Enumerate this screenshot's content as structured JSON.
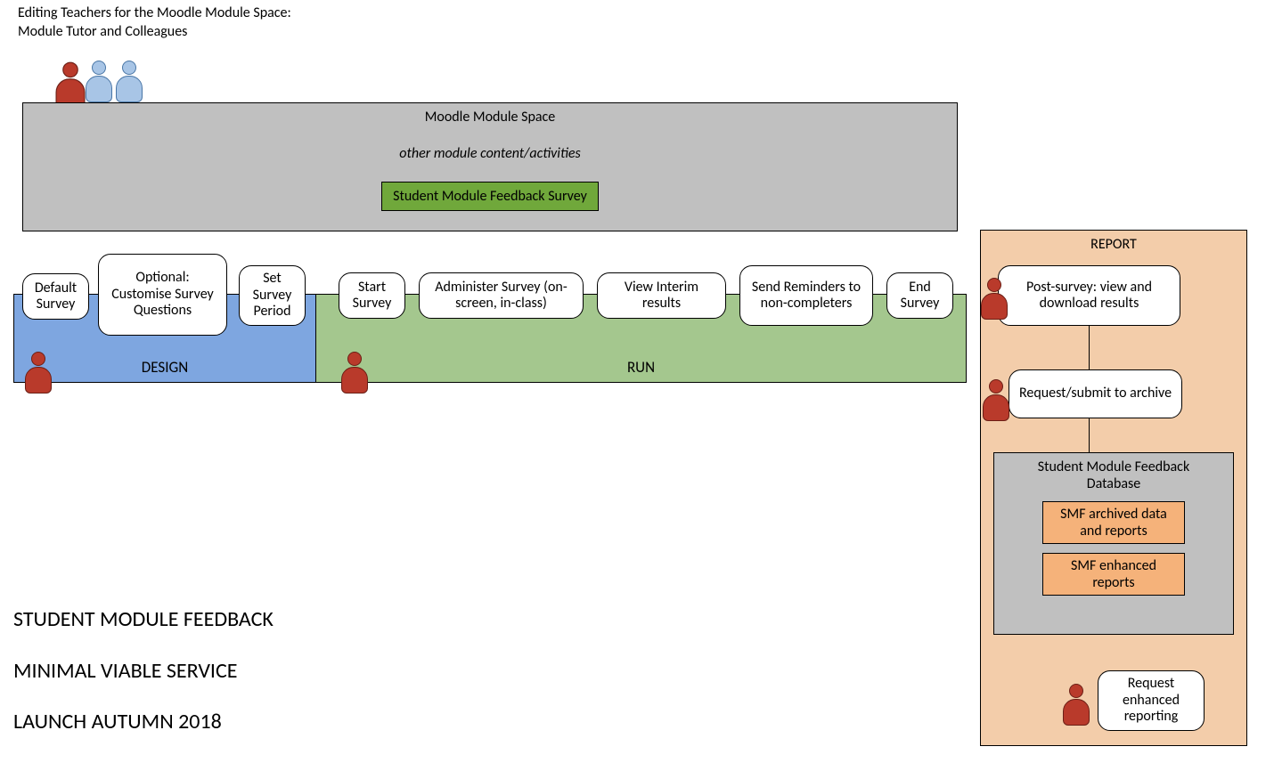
{
  "header": {
    "line1": "Editing Teachers for the Moodle Module Space:",
    "line2": "Module Tutor and Colleagues"
  },
  "moodle": {
    "title": "Moodle Module Space",
    "subtitle": "other module content/activities",
    "badge": "Student Module Feedback Survey"
  },
  "lanes": {
    "design": "DESIGN",
    "run": "RUN",
    "report": "REPORT"
  },
  "tasks": {
    "default_survey": "Default Survey",
    "customise": "Optional: Customise Survey Questions",
    "set_period": "Set Survey Period",
    "start_survey": "Start Survey",
    "administer": "Administer Survey (on-screen, in-class)",
    "view_interim": "View Interim results",
    "reminders": "Send Reminders to non-completers",
    "end_survey": "End Survey",
    "post_survey": "Post-survey: view and download results",
    "archive": "Request/submit to archive",
    "enhanced_req": "Request enhanced reporting"
  },
  "db": {
    "title": "Student Module Feedback Database",
    "item1": "SMF archived data and reports",
    "item2": "SMF enhanced reports"
  },
  "footer": {
    "l1": "STUDENT MODULE FEEDBACK",
    "l2": "MINIMAL VIABLE SERVICE",
    "l3": "LAUNCH AUTUMN 2018"
  }
}
